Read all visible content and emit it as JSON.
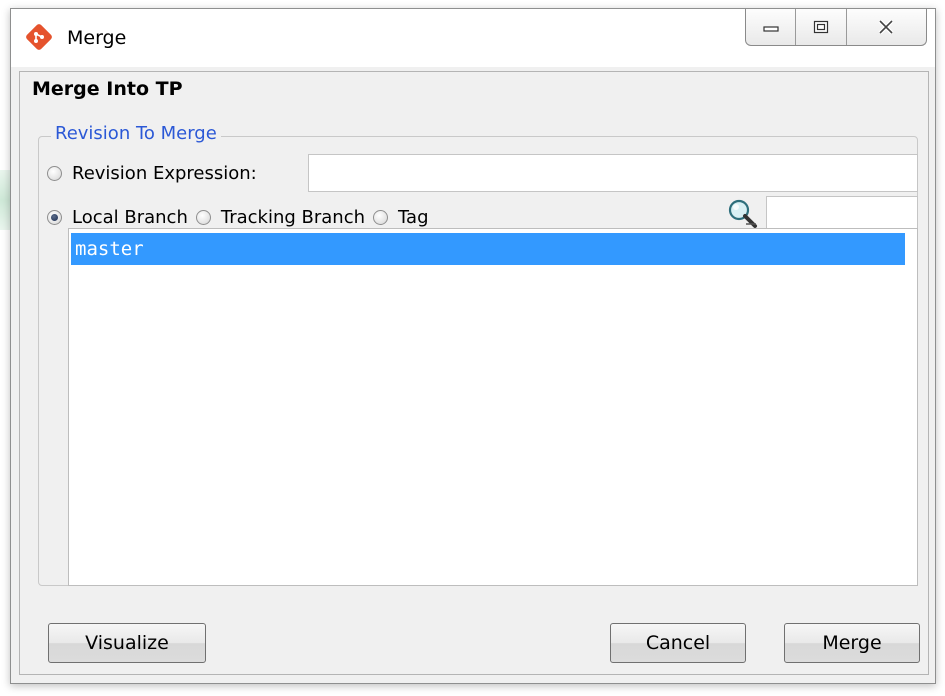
{
  "window": {
    "title": "Merge",
    "controls": [
      "minimize-icon",
      "maximize-icon",
      "close-icon"
    ]
  },
  "dialog": {
    "heading": "Merge Into TP",
    "group_label": "Revision To Merge",
    "revision_expression": {
      "label": "Revision Expression:",
      "value": "",
      "checked": false
    },
    "local_branch": {
      "label": "Local Branch",
      "checked": true
    },
    "tracking_branch": {
      "label": "Tracking Branch",
      "checked": false
    },
    "tag": {
      "label": "Tag",
      "checked": false
    },
    "filter_value": "",
    "branches": [
      {
        "name": "master",
        "selected": true
      }
    ]
  },
  "buttons": {
    "visualize": "Visualize",
    "cancel": "Cancel",
    "merge": "Merge"
  },
  "colors": {
    "selection": "#3399ff",
    "legend": "#2b58d6",
    "app_icon": "#e5532d"
  }
}
